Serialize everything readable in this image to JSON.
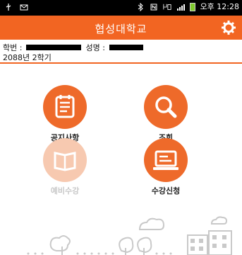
{
  "status_bar": {
    "clock": "오후 12:28",
    "icons": [
      "usb-icon",
      "mail-icon",
      "bluetooth-icon",
      "nfc-icon",
      "4g-icon",
      "signal-icon",
      "battery-icon"
    ]
  },
  "app_bar": {
    "title": "협성대학교",
    "settings_icon": "gear-icon"
  },
  "student_info": {
    "id_label": "학번 :",
    "name_label": "성명 :",
    "semester": "2088년 2학기"
  },
  "menu": {
    "items": [
      {
        "label": "공지사항",
        "icon": "notepad-icon",
        "enabled": true
      },
      {
        "label": "조회",
        "icon": "magnifier-icon",
        "enabled": true
      },
      {
        "label": "예비수강",
        "icon": "book-icon",
        "enabled": false
      },
      {
        "label": "수강신청",
        "icon": "computer-icon",
        "enabled": true
      }
    ]
  },
  "colors": {
    "accent": "#f26522",
    "icon_bg": "#ee6a2a",
    "icon_bg_disabled": "#f7c9b0",
    "label_disabled": "#c8c8c8"
  }
}
